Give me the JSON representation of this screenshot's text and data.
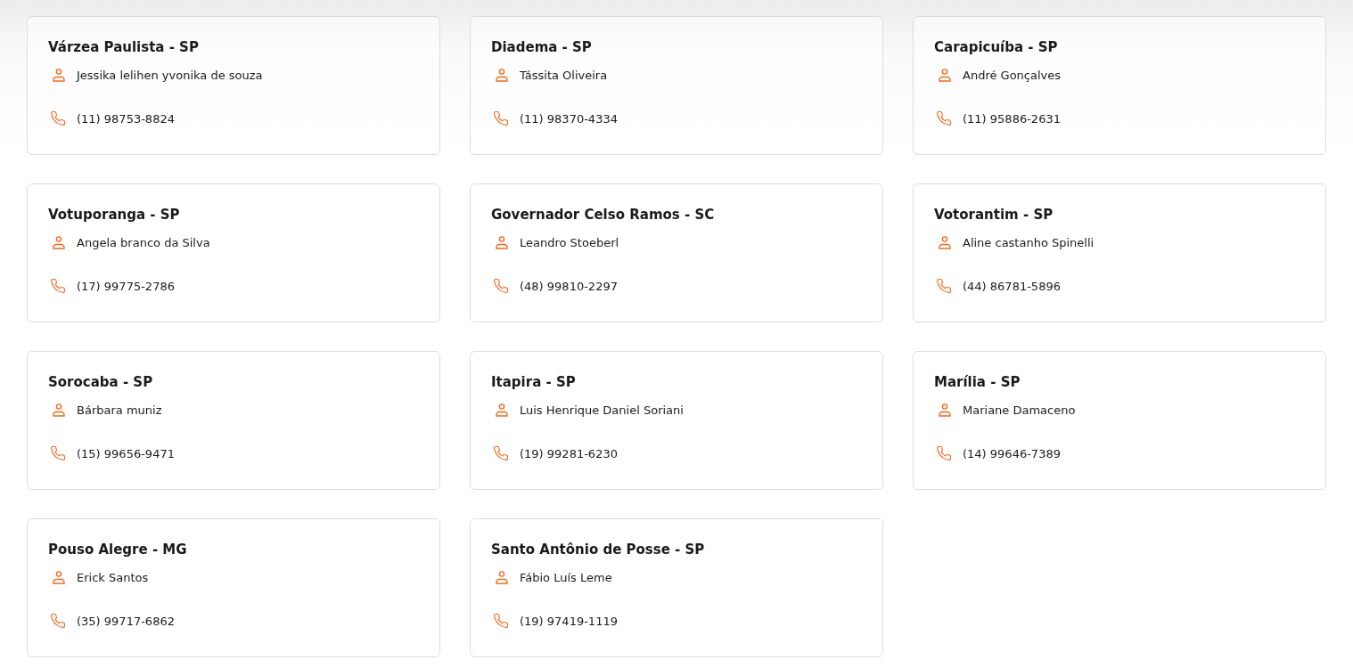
{
  "cards": [
    {
      "city": "Várzea Paulista - SP",
      "contact": "Jessika lelihen yvonika de souza",
      "phone": "(11) 98753-8824"
    },
    {
      "city": "Diadema - SP",
      "contact": "Tássita Oliveira",
      "phone": "(11) 98370-4334"
    },
    {
      "city": "Carapicuíba - SP",
      "contact": "André Gonçalves",
      "phone": "(11) 95886-2631"
    },
    {
      "city": "Votuporanga - SP",
      "contact": "Angela branco da Silva",
      "phone": "(17) 99775-2786"
    },
    {
      "city": "Governador Celso Ramos - SC",
      "contact": "Leandro Stoeberl",
      "phone": "(48) 99810-2297"
    },
    {
      "city": "Votorantim - SP",
      "contact": "Aline castanho Spinelli",
      "phone": "(44) 86781-5896"
    },
    {
      "city": "Sorocaba - SP",
      "contact": "Bárbara muniz",
      "phone": "(15) 99656-9471"
    },
    {
      "city": "Itapira - SP",
      "contact": "Luis Henrique Daniel Soriani",
      "phone": "(19) 99281-6230"
    },
    {
      "city": "Marília - SP",
      "contact": "Mariane Damaceno",
      "phone": "(14) 99646-7389"
    },
    {
      "city": "Pouso Alegre - MG",
      "contact": "Erick Santos",
      "phone": "(35) 99717-6862"
    },
    {
      "city": "Santo Antônio de Posse - SP",
      "contact": "Fábio Luís Leme",
      "phone": "(19) 97419-1119"
    }
  ]
}
